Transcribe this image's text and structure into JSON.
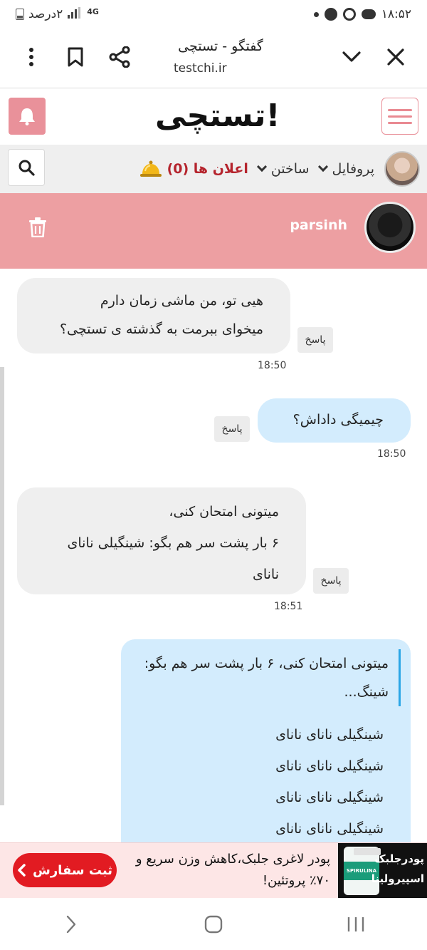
{
  "status_bar": {
    "time": "۱۸:۵۲",
    "battery": "۲درصد",
    "network": "4G"
  },
  "browser": {
    "title": "گفتگو - تستچی",
    "url": "testchi.ir"
  },
  "site": {
    "logo": "تستچی!"
  },
  "nav": {
    "profile": "پروفایل",
    "build": "ساختن",
    "notifications": "اعلان ها (0)"
  },
  "chat": {
    "user": "parsinh"
  },
  "reply_label": "پاسخ",
  "messages": [
    {
      "lines": [
        "هیی تو، من ماشی زمان دارم",
        "میخوای ببرمت به گذشته ی تستچی؟"
      ],
      "time": "18:50"
    },
    {
      "lines": [
        "چیمیگی داداش؟"
      ],
      "time": "18:50"
    },
    {
      "lines": [
        "میتونی امتحان کنی،",
        "۶ بار پشت سر هم بگو: شینگیلی نانای",
        "نانای"
      ],
      "time": "18:51"
    },
    {
      "quote": "میتونی امتحان کنی، ۶ بار پشت سر هم بگو: شینگ...",
      "lines": [
        "شینگیلی نانای نانای",
        "شینگیلی نانای نانای",
        "شینگیلی نانای نانای",
        "شینگیلی نانای نانای"
      ]
    }
  ],
  "ad": {
    "button": "ثبت سفارش",
    "text": "پودر لاغری جلبک،کاهش وزن سریع و ۷۰٪ پروتئین!",
    "image_text": "پودرجلبک اسپیرولینا",
    "bottle_label": "SPIRULINA"
  },
  "colors": {
    "accent_pink": "#ed9fa2",
    "bubble_in": "#efefef",
    "bubble_out": "#d3ecfd",
    "notif_red": "#b5242d",
    "ad_button": "#e21b22"
  }
}
